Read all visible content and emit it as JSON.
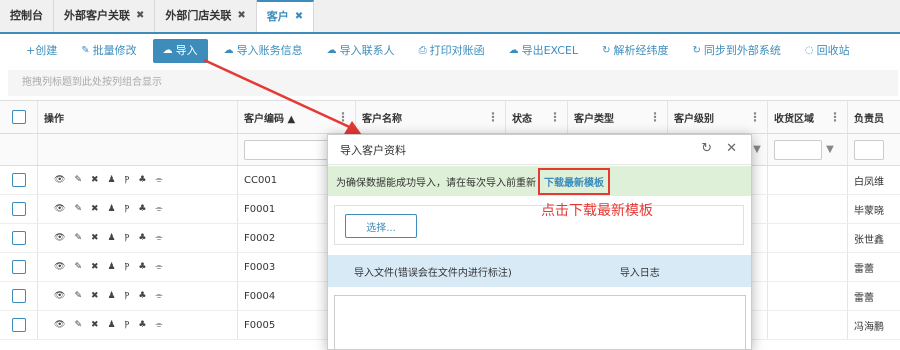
{
  "tabs": [
    {
      "label": "控制台",
      "closable": false
    },
    {
      "label": "外部客户关联",
      "closable": true
    },
    {
      "label": "外部门店关联",
      "closable": true
    },
    {
      "label": "客户",
      "closable": true,
      "active": true
    }
  ],
  "toolbar": {
    "create": "+创建",
    "batch_edit": "批量修改",
    "import": "导入",
    "import_account": "导入账务信息",
    "import_contact": "导入联系人",
    "print_statement": "打印对账函",
    "export_excel": "导出EXCEL",
    "parse_coords": "解析经纬度",
    "sync_external": "同步到外部系统",
    "recycle": "回收站"
  },
  "group_hint": "拖拽列标题到此处按列组合显示",
  "grid": {
    "columns": {
      "ops": "操作",
      "code": "客户编码 ▲",
      "name": "客户名称",
      "status": "状态",
      "type": "客户类型",
      "level": "客户级别",
      "area": "收货区域",
      "owner": "负责员"
    },
    "rows": [
      {
        "code": "CC001",
        "owner": "白凤维"
      },
      {
        "code": "F0001",
        "owner": "毕蒙晓"
      },
      {
        "code": "F0002",
        "owner": "张世鑫"
      },
      {
        "code": "F0003",
        "owner": "雷蕾"
      },
      {
        "code": "F0004",
        "owner": "雷蕾"
      },
      {
        "code": "F0005",
        "owner": "冯海鹏"
      }
    ]
  },
  "modal": {
    "title": "导入客户资料",
    "notice_text": "为确保数据能成功导入，请在每次导入前重新",
    "download_link": "下载最新模板",
    "select_button": "选择...",
    "tab_file": "导入文件(错误会在文件内进行标注)",
    "tab_log": "导入日志"
  },
  "annotation": "点击下载最新模板",
  "colors": {
    "accent": "#3c8dbc",
    "annotation": "#e53935",
    "notice_bg": "#dff0d8"
  }
}
